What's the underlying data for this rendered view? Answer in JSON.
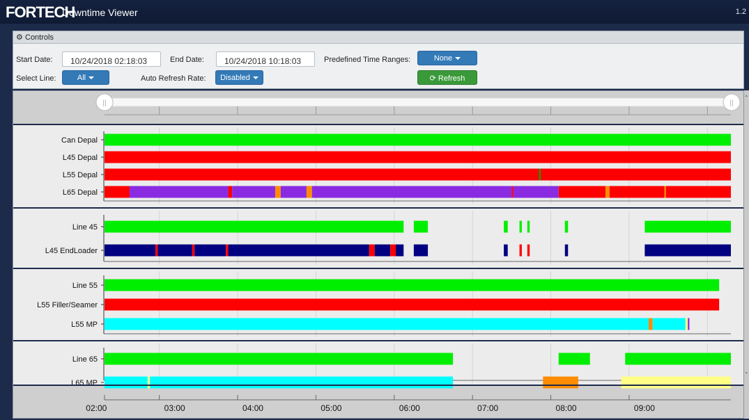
{
  "app": {
    "logo": "FORTECH",
    "title": "Downtime Viewer",
    "version": "1.2"
  },
  "controls": {
    "header": "Controls",
    "start_date_label": "Start Date:",
    "start_date_value": "10/24/2018 02:18:03",
    "end_date_label": "End Date:",
    "end_date_value": "10/24/2018 10:18:03",
    "predefined_label": "Predefined Time Ranges:",
    "predefined_value": "None",
    "select_line_label": "Select Line:",
    "select_line_value": "All",
    "auto_refresh_label": "Auto Refresh Rate:",
    "auto_refresh_value": "Disabled",
    "refresh_label": "Refresh"
  },
  "colors": {
    "running": "#00ee00",
    "down": "#ff0000",
    "purple": "#8a2be2",
    "navy": "#000080",
    "cyan": "#00ffff",
    "yellow": "#ffff88",
    "orange": "#ff8c00"
  },
  "chart_data": {
    "type": "timeline",
    "x_axis": {
      "start": "02:18",
      "end": "10:18",
      "ticks": [
        "02:00",
        "03:00",
        "04:00",
        "05:00",
        "06:00",
        "07:00",
        "08:00",
        "09:00"
      ]
    },
    "panels": [
      {
        "rows": [
          {
            "label": "Can Depal",
            "segments": [
              {
                "start": 2.3,
                "end": 10.3,
                "color": "#00ee00"
              }
            ]
          },
          {
            "label": "L45 Depal",
            "segments": [
              {
                "start": 2.3,
                "end": 10.3,
                "color": "#ff0000"
              }
            ]
          },
          {
            "label": "L55 Depal",
            "segments": [
              {
                "start": 2.3,
                "end": 10.3,
                "color": "#ff0000"
              },
              {
                "start": 7.85,
                "end": 7.87,
                "color": "#00aa00"
              }
            ]
          },
          {
            "label": "L65 Depal",
            "segments": [
              {
                "start": 2.3,
                "end": 2.62,
                "color": "#ff0000"
              },
              {
                "start": 2.62,
                "end": 3.88,
                "color": "#8a2be2"
              },
              {
                "start": 3.88,
                "end": 3.93,
                "color": "#ff0000"
              },
              {
                "start": 3.93,
                "end": 4.48,
                "color": "#8a2be2"
              },
              {
                "start": 4.48,
                "end": 4.55,
                "color": "#ff8c00"
              },
              {
                "start": 4.55,
                "end": 4.88,
                "color": "#8a2be2"
              },
              {
                "start": 4.88,
                "end": 4.95,
                "color": "#ff8c00"
              },
              {
                "start": 4.95,
                "end": 7.5,
                "color": "#8a2be2"
              },
              {
                "start": 7.5,
                "end": 7.52,
                "color": "#ff0000"
              },
              {
                "start": 7.52,
                "end": 8.1,
                "color": "#8a2be2"
              },
              {
                "start": 8.1,
                "end": 8.7,
                "color": "#ff0000"
              },
              {
                "start": 8.7,
                "end": 8.75,
                "color": "#ff8c00"
              },
              {
                "start": 8.75,
                "end": 9.45,
                "color": "#ff0000"
              },
              {
                "start": 9.45,
                "end": 9.47,
                "color": "#ff8c00"
              },
              {
                "start": 9.47,
                "end": 10.3,
                "color": "#ff0000"
              }
            ]
          }
        ]
      },
      {
        "rows": [
          {
            "label": "Line 45",
            "segments": [
              {
                "start": 2.3,
                "end": 6.12,
                "color": "#00ee00"
              },
              {
                "start": 6.25,
                "end": 6.43,
                "color": "#00ee00"
              },
              {
                "start": 7.4,
                "end": 7.45,
                "color": "#00ee00"
              },
              {
                "start": 7.6,
                "end": 7.63,
                "color": "#00ee00"
              },
              {
                "start": 7.7,
                "end": 7.73,
                "color": "#00ee00"
              },
              {
                "start": 8.18,
                "end": 8.22,
                "color": "#00ee00"
              },
              {
                "start": 9.2,
                "end": 10.3,
                "color": "#00ee00"
              }
            ]
          },
          {
            "label": "L45 EndLoader",
            "segments": [
              {
                "start": 2.3,
                "end": 2.95,
                "color": "#000080"
              },
              {
                "start": 2.95,
                "end": 2.98,
                "color": "#ff0000"
              },
              {
                "start": 2.98,
                "end": 3.42,
                "color": "#000080"
              },
              {
                "start": 3.42,
                "end": 3.45,
                "color": "#ff0000"
              },
              {
                "start": 3.45,
                "end": 3.85,
                "color": "#000080"
              },
              {
                "start": 3.85,
                "end": 3.88,
                "color": "#ff0000"
              },
              {
                "start": 3.88,
                "end": 5.68,
                "color": "#000080"
              },
              {
                "start": 5.68,
                "end": 5.75,
                "color": "#ff0000"
              },
              {
                "start": 5.75,
                "end": 5.95,
                "color": "#000080"
              },
              {
                "start": 5.95,
                "end": 6.02,
                "color": "#ff0000"
              },
              {
                "start": 6.02,
                "end": 6.12,
                "color": "#000080"
              },
              {
                "start": 6.25,
                "end": 6.43,
                "color": "#000080"
              },
              {
                "start": 7.4,
                "end": 7.45,
                "color": "#000080"
              },
              {
                "start": 7.6,
                "end": 7.63,
                "color": "#ff0000"
              },
              {
                "start": 7.7,
                "end": 7.73,
                "color": "#ff0000"
              },
              {
                "start": 8.18,
                "end": 8.22,
                "color": "#000080"
              },
              {
                "start": 9.2,
                "end": 10.3,
                "color": "#000080"
              }
            ]
          }
        ]
      },
      {
        "rows": [
          {
            "label": "Line 55",
            "segments": [
              {
                "start": 2.3,
                "end": 10.15,
                "color": "#00ee00"
              }
            ]
          },
          {
            "label": "L55 Filler/Seamer",
            "segments": [
              {
                "start": 2.3,
                "end": 10.15,
                "color": "#ff0000"
              }
            ]
          },
          {
            "label": "L55 MP",
            "segments": [
              {
                "start": 2.3,
                "end": 9.25,
                "color": "#00ffff"
              },
              {
                "start": 9.25,
                "end": 9.3,
                "color": "#ff8c00"
              },
              {
                "start": 9.3,
                "end": 9.72,
                "color": "#00ffff"
              },
              {
                "start": 9.72,
                "end": 9.75,
                "color": "#ffff88"
              },
              {
                "start": 9.75,
                "end": 9.77,
                "color": "#8a2be2"
              }
            ]
          }
        ]
      },
      {
        "rows": [
          {
            "label": "Line 65",
            "segments": [
              {
                "start": 2.3,
                "end": 6.75,
                "color": "#00ee00"
              },
              {
                "start": 8.1,
                "end": 8.5,
                "color": "#00ee00"
              },
              {
                "start": 8.95,
                "end": 10.3,
                "color": "#00ee00"
              }
            ]
          },
          {
            "label": "L65 MP",
            "segments": [
              {
                "start": 2.3,
                "end": 2.85,
                "color": "#00ffff"
              },
              {
                "start": 2.85,
                "end": 2.88,
                "color": "#ffff88"
              },
              {
                "start": 2.88,
                "end": 6.75,
                "color": "#00ffff"
              },
              {
                "start": 7.9,
                "end": 8.35,
                "color": "#ff8c00"
              },
              {
                "start": 8.9,
                "end": 10.3,
                "color": "#ffff88"
              }
            ]
          }
        ]
      }
    ]
  }
}
